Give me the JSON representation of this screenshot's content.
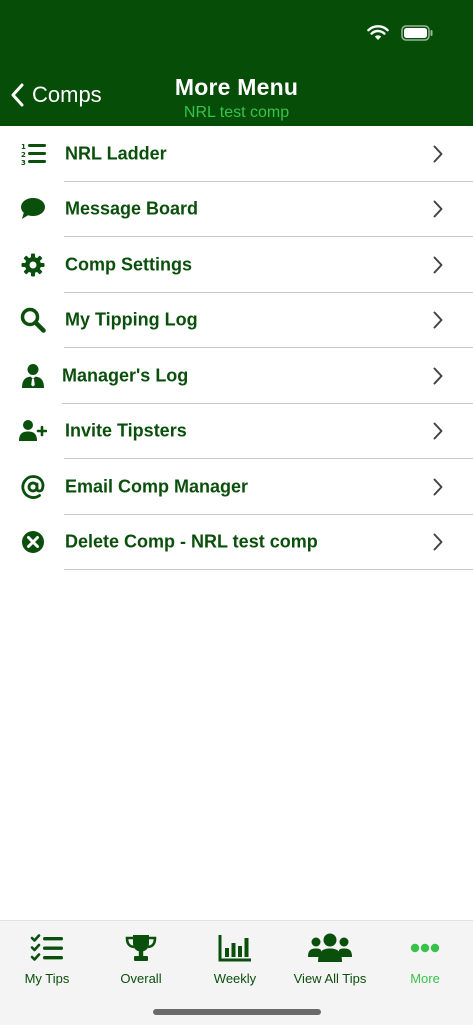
{
  "colors": {
    "header_bg": "#064d08",
    "accent": "#38c24b",
    "label": "#0a4f0c"
  },
  "header": {
    "back_label": "Comps",
    "title": "More Menu",
    "subtitle": "NRL test comp"
  },
  "menu": {
    "items": [
      {
        "label": "NRL Ladder",
        "icon": "ranked-list-icon"
      },
      {
        "label": "Message Board",
        "icon": "speech-bubble-icon"
      },
      {
        "label": "Comp Settings",
        "icon": "gear-icon"
      },
      {
        "label": "My Tipping Log",
        "icon": "magnifier-icon"
      },
      {
        "label": "Manager's Log",
        "icon": "manager-icon"
      },
      {
        "label": "Invite Tipsters",
        "icon": "add-user-icon"
      },
      {
        "label": "Email Comp Manager",
        "icon": "at-sign-icon"
      },
      {
        "label": "Delete Comp - NRL test comp",
        "icon": "close-circle-icon"
      }
    ]
  },
  "tabbar": {
    "tabs": [
      {
        "label": "My Tips",
        "icon": "checklist-icon"
      },
      {
        "label": "Overall",
        "icon": "trophy-icon"
      },
      {
        "label": "Weekly",
        "icon": "bar-chart-icon"
      },
      {
        "label": "View All Tips",
        "icon": "users-icon"
      },
      {
        "label": "More",
        "icon": "ellipsis-icon",
        "active": true
      }
    ]
  }
}
